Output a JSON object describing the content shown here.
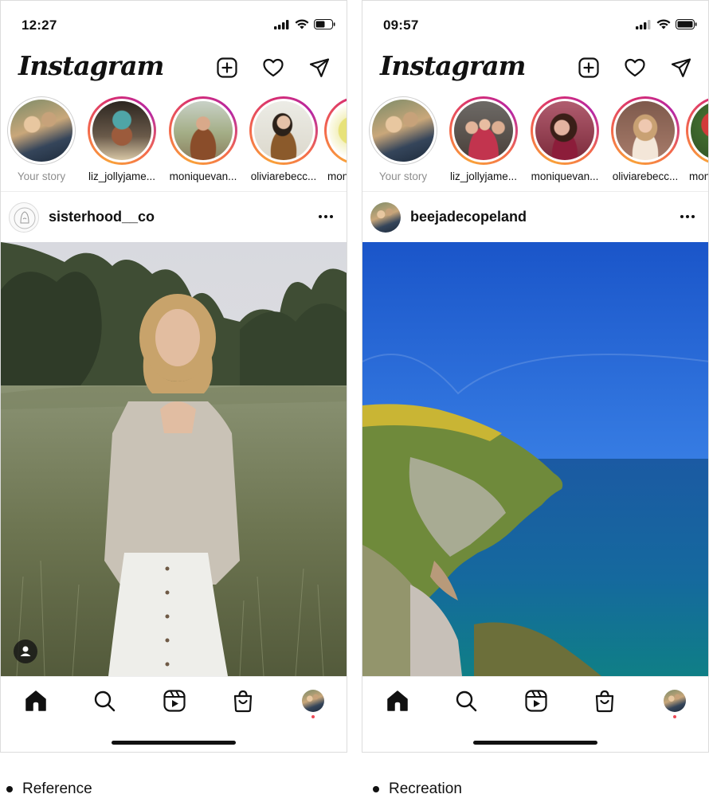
{
  "panels": [
    {
      "status_time": "12:27",
      "logo": "Instagram",
      "stories": [
        {
          "name": "Your story"
        },
        {
          "name": "liz_jollyjame..."
        },
        {
          "name": "moniquevan..."
        },
        {
          "name": "oliviarebecc..."
        },
        {
          "name": "mon"
        }
      ],
      "post_user": "sisterhood__co",
      "caption": "Reference"
    },
    {
      "status_time": "09:57",
      "logo": "Instagram",
      "stories": [
        {
          "name": "Your story"
        },
        {
          "name": "liz_jollyjame..."
        },
        {
          "name": "moniquevan..."
        },
        {
          "name": "oliviarebecc..."
        },
        {
          "name": "mon"
        }
      ],
      "post_user": "beejadecopeland",
      "caption": "Recreation"
    }
  ],
  "icons": {
    "create": "plus-square-icon",
    "activity": "heart-icon",
    "messages": "paper-plane-icon",
    "more": "ellipsis-icon",
    "home": "home-icon",
    "search": "search-icon",
    "reels": "reels-icon",
    "shop": "shopping-bag-icon",
    "tag": "person-tag-icon"
  },
  "colors": {
    "story_ring": [
      "#f9a13a",
      "#d62c72",
      "#b728a3"
    ],
    "notification_dot": "#ed4956",
    "muted_text": "#8e8e8e"
  }
}
